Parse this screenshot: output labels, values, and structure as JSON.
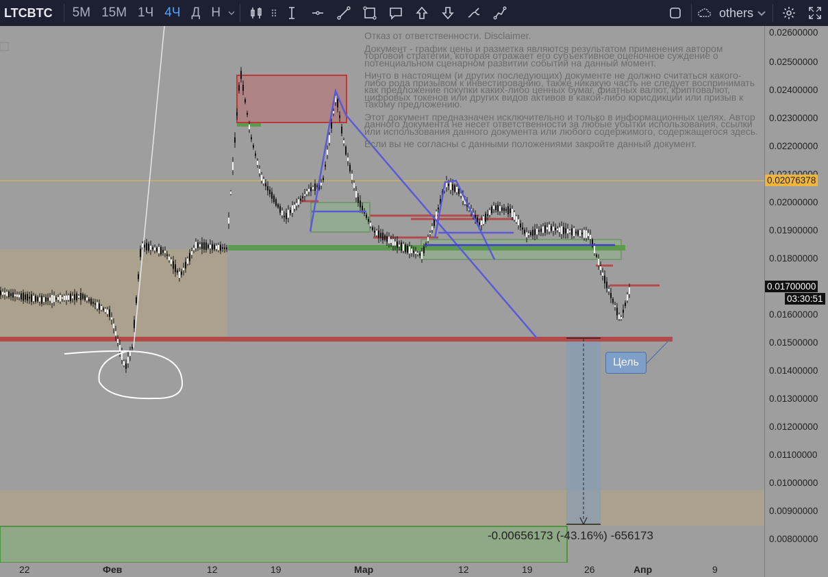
{
  "toolbar": {
    "symbol": "LTCBTC",
    "timeframes": [
      "5M",
      "15M",
      "1Ч",
      "4Ч",
      "Д",
      "Н"
    ],
    "active_timeframe": "4Ч",
    "others_label": "others",
    "tools": [
      "cursor-tool",
      "horizontal-line-tool",
      "trend-line-tool",
      "rectangle-tool",
      "callout-tool",
      "arrow-up-tool",
      "arrow-down-tool",
      "brush-tool",
      "path-tool"
    ]
  },
  "price_axis": {
    "labels": [
      "0.02600000",
      "0.02500000",
      "0.02400000",
      "0.02300000",
      "0.02200000",
      "0.02100000",
      "0.02000000",
      "0.01900000",
      "0.01800000",
      "0.01600000",
      "0.01500000",
      "0.01400000",
      "0.01300000",
      "0.01200000",
      "0.01100000",
      "0.01000000",
      "0.00900000",
      "0.00800000"
    ],
    "current_price_label": "0.01700000",
    "countdown": "03:30:51",
    "line_price_label": "0.02076378"
  },
  "time_axis": {
    "labels": [
      "22",
      "Фев",
      "12",
      "19",
      "Мар",
      "12",
      "19",
      "26",
      "Апр",
      "9"
    ]
  },
  "disclaimer": [
    "Отказ от ответственности. Disclaimer.",
    "Документ - график цены и разметка являются результатом применения автором торговой стратегии, которая отражает его субъективное оценочное суждение о потенциальном сценарном развитии событий на данный момент.",
    "Ничто в настоящем (и других последующих) документе не должно считаться какого-либо рода призывом к инвестированию, также никакую часть не следует воспринимать как предложение покупки каких-либо ценных бумаг, фиатных валют, криптовалют, цифровых токенов или других видов активов в какой-либо юрисдикции или призыв к такому предложению.",
    "Этот документ предназначен исключительно и только в информационных целях. Автор данного документа не несет ответственности за любые убытки использования, ссылки или использования данного документа или любого содержимого, содержащегося здесь.",
    "Если вы не согласны с данными положениями закройте данный документ."
  ],
  "measure_label": "-0.00656173 (-43.16%) -656173",
  "goal_label": "Цель",
  "colors": {
    "background": "#9e9e9e",
    "toolbar": "#1c2030",
    "active_timeframe": "#4aa3ff",
    "support_line": "#b34a4a",
    "green_zone": "#5c9a4f",
    "tan_zone": "#b3a585",
    "trend_line": "#5a5ad8",
    "price_line": "#f0b63c"
  }
}
